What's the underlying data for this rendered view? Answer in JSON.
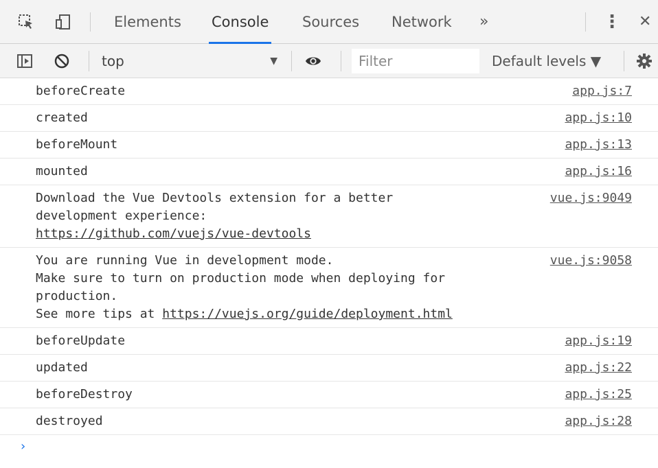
{
  "tabs": [
    "Elements",
    "Console",
    "Sources",
    "Network"
  ],
  "more_tabs_label": "»",
  "menu_label": "⋮",
  "close_label": "✕",
  "context": {
    "value": "top",
    "arrow": "▼"
  },
  "filter": {
    "placeholder": "Filter",
    "value": ""
  },
  "levels": {
    "label": "Default levels ▼"
  },
  "logs": [
    {
      "lines": [
        "beforeCreate"
      ],
      "source": "app.js:7"
    },
    {
      "lines": [
        "created"
      ],
      "source": "app.js:10"
    },
    {
      "lines": [
        "beforeMount"
      ],
      "source": "app.js:13"
    },
    {
      "lines": [
        "mounted"
      ],
      "source": "app.js:16"
    },
    {
      "lines": [
        "Download the Vue Devtools extension for a better",
        "development experience:"
      ],
      "link": "https://github.com/vuejs/vue-devtools",
      "source": "vue.js:9049"
    },
    {
      "lines": [
        "You are running Vue in development mode.",
        "Make sure to turn on production mode when deploying for",
        "production."
      ],
      "prefix": "See more tips at ",
      "link": "https://vuejs.org/guide/deployment.html",
      "source": "vue.js:9058"
    },
    {
      "lines": [
        "beforeUpdate"
      ],
      "source": "app.js:19"
    },
    {
      "lines": [
        "updated"
      ],
      "source": "app.js:22"
    },
    {
      "lines": [
        "beforeDestroy"
      ],
      "source": "app.js:25"
    },
    {
      "lines": [
        "destroyed"
      ],
      "source": "app.js:28"
    }
  ],
  "prompt": "›",
  "colors": {
    "accent": "#1a73e8",
    "toolbar_bg": "#f3f3f3"
  }
}
